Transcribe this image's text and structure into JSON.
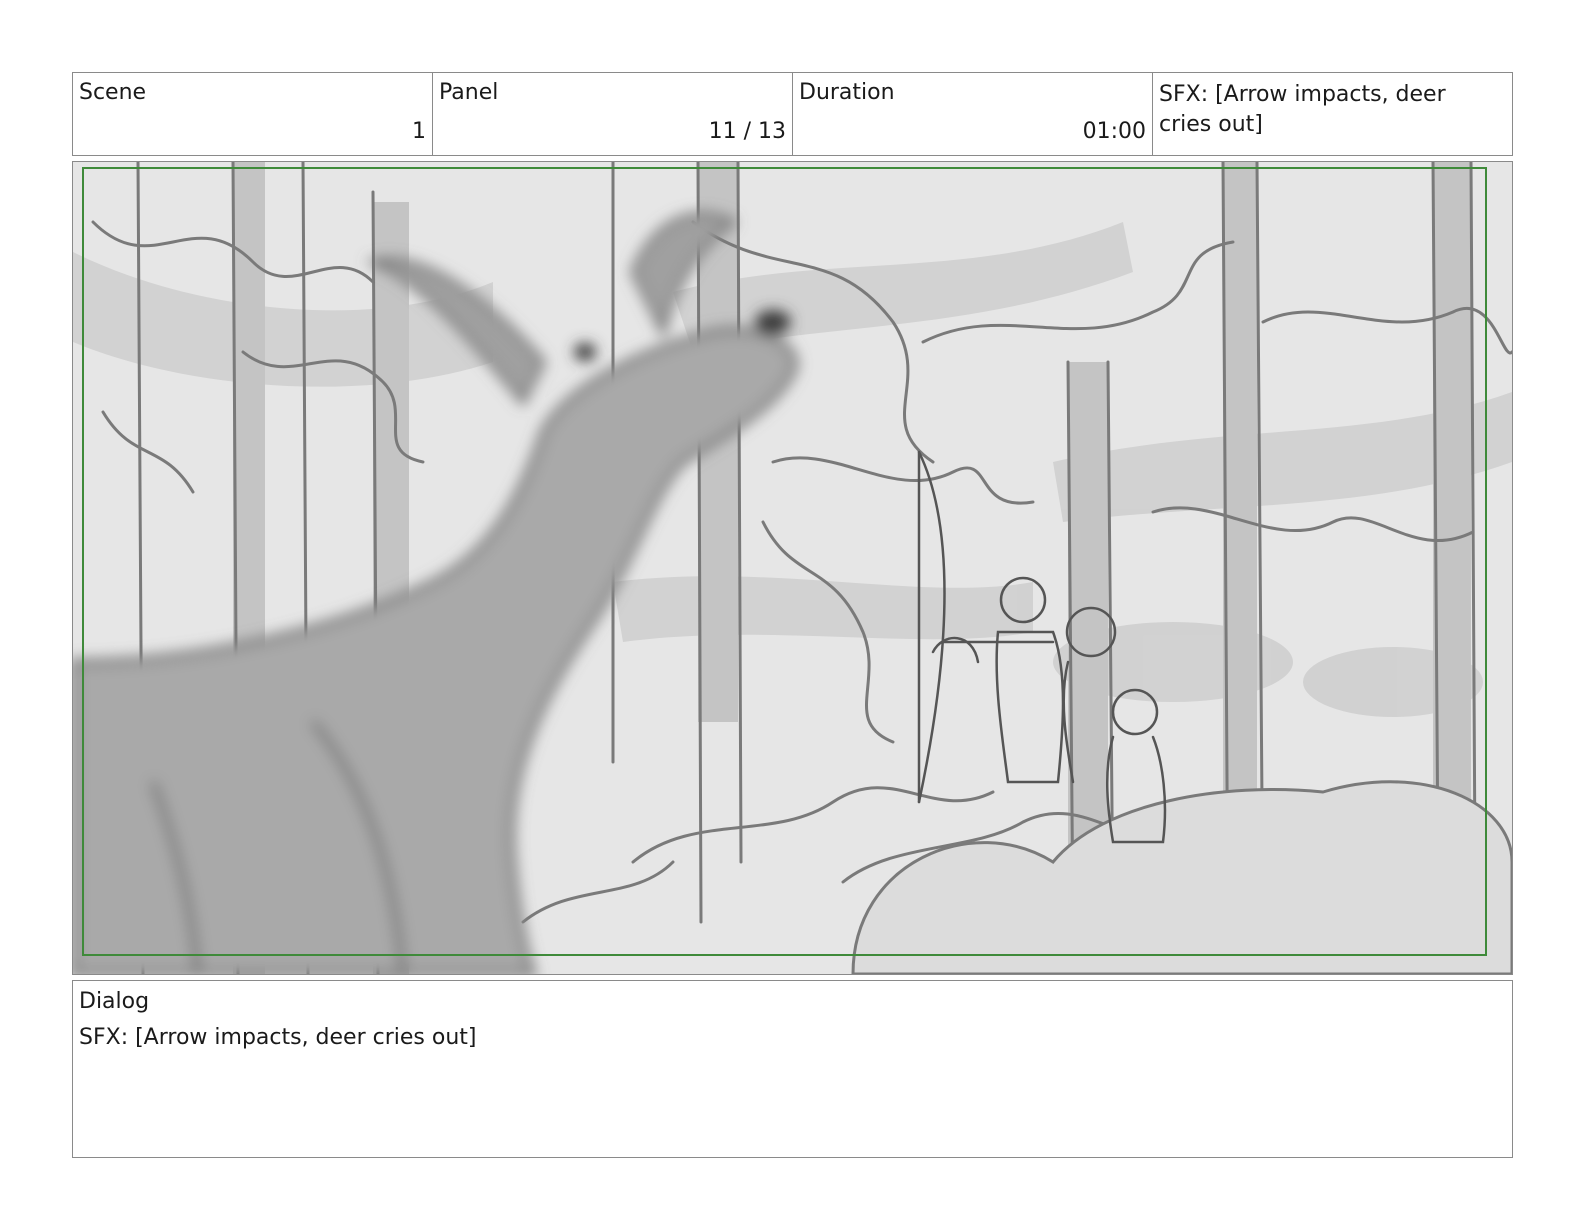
{
  "header": {
    "scene": {
      "label": "Scene",
      "value": "1"
    },
    "panel": {
      "label": "Panel",
      "value": "11 / 13"
    },
    "duration": {
      "label": "Duration",
      "value": "01:00"
    },
    "notes": {
      "text": "SFX: [Arrow impacts, deer cries out]"
    }
  },
  "dialog": {
    "label": "Dialog",
    "text": "SFX: [Arrow impacts, deer cries out]"
  },
  "colors": {
    "safe_frame": "#3f8a3a",
    "sketch_line": "#6f6f6f",
    "sketch_fill": "#bdbdbd",
    "background": "#e4e4e4"
  }
}
